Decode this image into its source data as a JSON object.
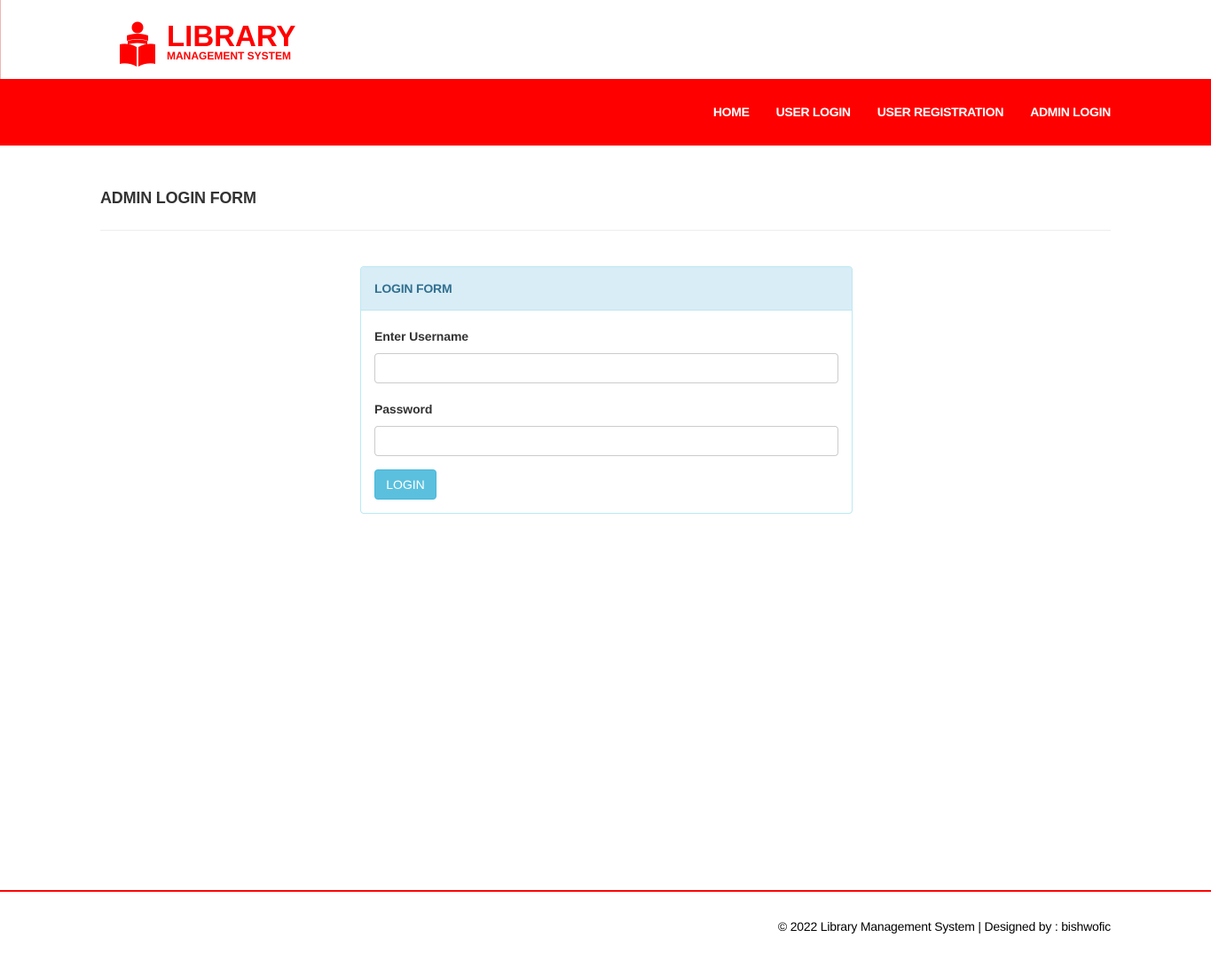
{
  "header": {
    "logo_title": "LIBRARY",
    "logo_subtitle": "MANAGEMENT SYSTEM",
    "logo_icon": "reader-book-icon",
    "brand_color": "#ff0000"
  },
  "nav": {
    "items": [
      {
        "label": "HOME"
      },
      {
        "label": "USER LOGIN"
      },
      {
        "label": "USER REGISTRATION"
      },
      {
        "label": "ADMIN LOGIN"
      }
    ]
  },
  "main": {
    "page_title": "ADMIN LOGIN FORM",
    "panel": {
      "heading": "LOGIN FORM",
      "username_label": "Enter Username",
      "username_value": "",
      "password_label": "Password",
      "password_value": "",
      "login_button": "LOGIN"
    }
  },
  "footer": {
    "text": "© 2022 Library Management System | Designed by : bishwofic"
  }
}
